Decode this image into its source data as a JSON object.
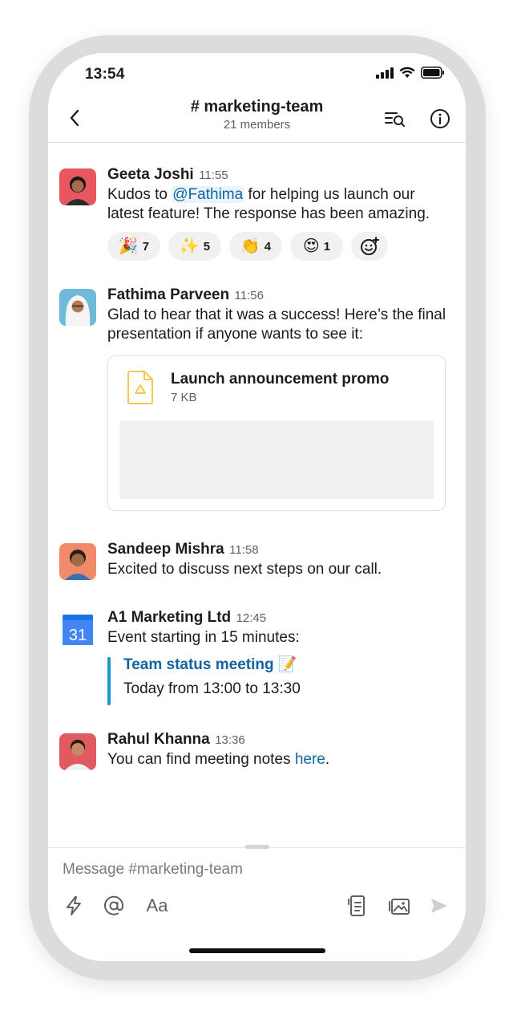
{
  "status_bar": {
    "time": "13:54"
  },
  "header": {
    "channel_title": "# marketing-team",
    "members": "21 members"
  },
  "messages": [
    {
      "sender": "Geeta Joshi",
      "time": "11:55",
      "text_before": "Kudos to ",
      "mention": "@Fathima",
      "text_after": " for helping us launch our latest feature! The response has been amazing.",
      "reactions": [
        {
          "emoji": "🎉",
          "count": "7"
        },
        {
          "emoji": "✨",
          "count": "5"
        },
        {
          "emoji": "👏",
          "count": "4"
        },
        {
          "emoji": "😍",
          "count": "1"
        }
      ]
    },
    {
      "sender": "Fathima Parveen",
      "time": "11:56",
      "text": "Glad to hear that it was a success! Here’s the final presentation if anyone wants to see it:",
      "file": {
        "name": "Launch announcement promo",
        "size": "7 KB"
      }
    },
    {
      "sender": "Sandeep Mishra",
      "time": "11:58",
      "text": "Excited to discuss next steps on our call."
    },
    {
      "sender": "A1 Marketing Ltd",
      "time": "12:45",
      "calendar_day": "31",
      "text": "Event starting in 15 minutes:",
      "event": {
        "title": "Team status meeting",
        "emoji": "📝",
        "time": "Today from 13:00 to 13:30"
      }
    },
    {
      "sender": "Rahul Khanna",
      "time": "13:36",
      "text_before": "You can find meeting notes ",
      "link": "here",
      "text_after": "."
    }
  ],
  "composer": {
    "placeholder": "Message #marketing-team",
    "format_label": "Aa"
  },
  "icons": {
    "back": "chevron-left-icon",
    "search": "search-in-channel-icon",
    "info": "info-icon",
    "shortcuts": "lightning-icon",
    "mention": "at-icon",
    "format": "text-format-icon",
    "file": "file-icon",
    "photo": "photo-icon",
    "send": "send-icon"
  },
  "colors": {
    "link": "#1264a3",
    "event_bar": "#1b96d1",
    "mention_bg": "#e8f5fa"
  }
}
